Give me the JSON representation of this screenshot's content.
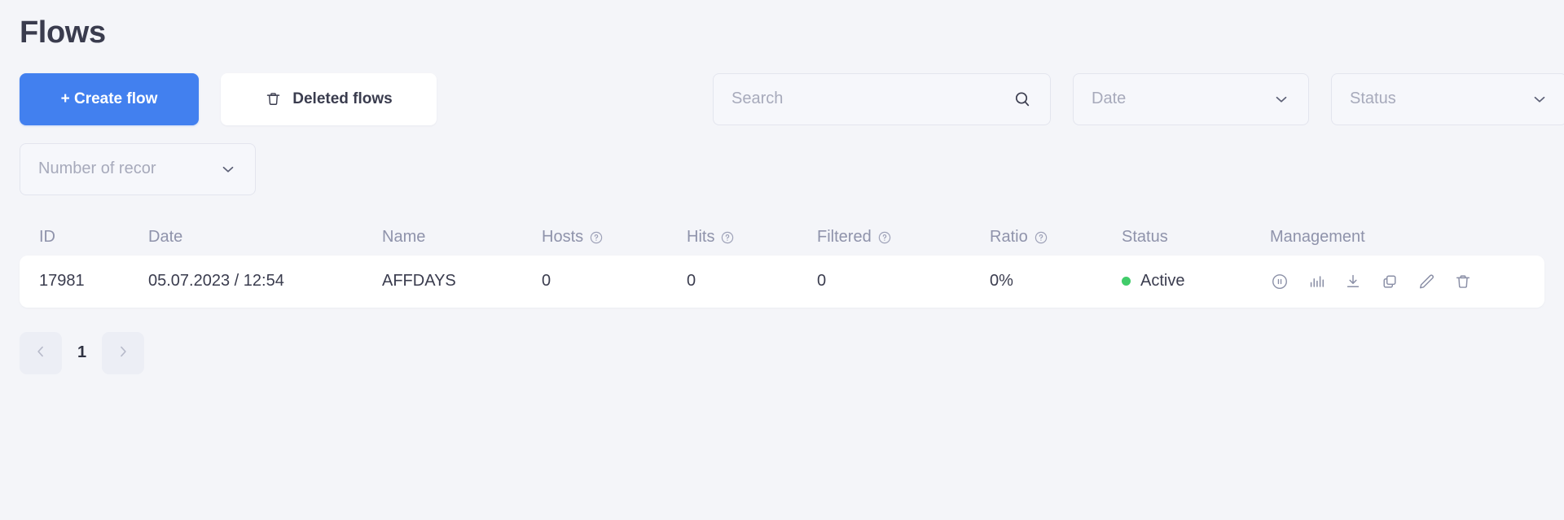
{
  "header": {
    "title": "Flows"
  },
  "toolbar": {
    "create_flow_label": "+ Create flow",
    "deleted_flows_label": "Deleted flows",
    "deleted_flows_icon": "trash-icon"
  },
  "filters": {
    "search": {
      "placeholder": "Search",
      "value": "",
      "icon": "search-icon"
    },
    "date": {
      "label": "Date",
      "icon": "chevron-down-icon"
    },
    "status": {
      "label": "Status",
      "icon": "chevron-down-icon"
    },
    "records": {
      "label": "Number of recor",
      "icon": "chevron-down-icon"
    }
  },
  "table": {
    "columns": [
      {
        "key": "id",
        "label": "ID",
        "help": false
      },
      {
        "key": "date",
        "label": "Date",
        "help": false
      },
      {
        "key": "name",
        "label": "Name",
        "help": false
      },
      {
        "key": "hosts",
        "label": "Hosts",
        "help": true
      },
      {
        "key": "hits",
        "label": "Hits",
        "help": true
      },
      {
        "key": "filtered",
        "label": "Filtered",
        "help": true
      },
      {
        "key": "ratio",
        "label": "Ratio",
        "help": true
      },
      {
        "key": "status",
        "label": "Status",
        "help": false
      },
      {
        "key": "management",
        "label": "Management",
        "help": false
      }
    ],
    "rows": [
      {
        "id": "17981",
        "date": "05.07.2023 / 12:54",
        "name": "AFFDAYS",
        "hosts": "0",
        "hits": "0",
        "filtered": "0",
        "ratio": "0%",
        "status": "Active",
        "status_color": "#41cc6a",
        "actions": [
          "pause-circle-icon",
          "bar-chart-icon",
          "download-icon",
          "copy-icon",
          "edit-pencil-icon",
          "trash-icon"
        ]
      }
    ]
  },
  "pagination": {
    "prev_icon": "chevron-left-icon",
    "next_icon": "chevron-right-icon",
    "current_page": "1"
  },
  "colors": {
    "background": "#f4f5f9",
    "primary": "#4280ef",
    "text": "#3a3c4e",
    "muted": "#8f93ab",
    "card": "#ffffff",
    "status_active": "#41cc6a"
  }
}
